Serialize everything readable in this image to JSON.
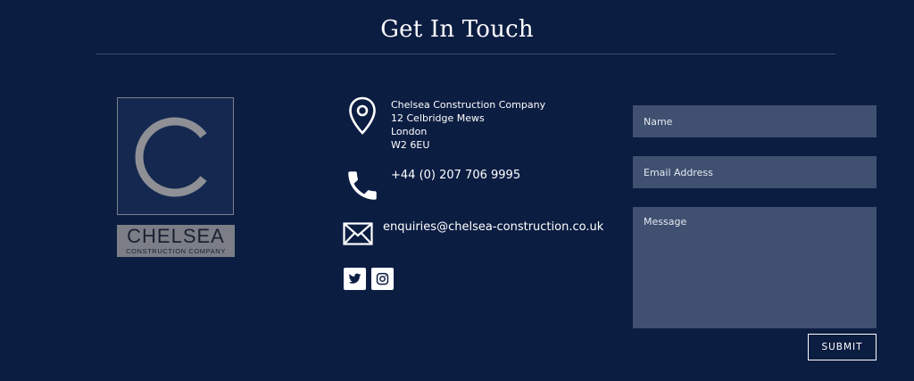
{
  "section": {
    "title": "Get In Touch"
  },
  "logo": {
    "letter": "C",
    "word": "CHELSEA",
    "subtitle": "CONSTRUCTION COMPANY"
  },
  "contact": {
    "address_lines": [
      "Chelsea Construction Company",
      "12 Celbridge Mews",
      "London",
      "W2 6EU"
    ],
    "phone": "+44 (0) 207 706 9995",
    "email": "enquiries@chelsea-construction.co.uk",
    "icons": {
      "address": "map-pin-icon",
      "phone": "phone-icon",
      "email": "envelope-icon"
    }
  },
  "social": [
    {
      "name": "twitter",
      "icon": "twitter-icon"
    },
    {
      "name": "instagram",
      "icon": "instagram-icon"
    }
  ],
  "form": {
    "name_placeholder": "Name",
    "email_placeholder": "Email Address",
    "message_placeholder": "Message",
    "submit_label": "SUBMIT"
  },
  "colors": {
    "background": "#0c1d42",
    "field": "#3f5071",
    "logo_grey": "#7b7e86"
  }
}
